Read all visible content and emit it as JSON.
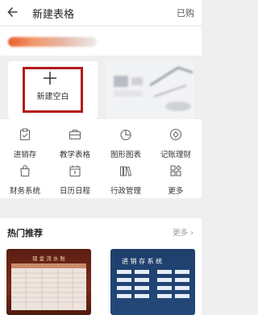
{
  "header": {
    "title": "新建表格",
    "purchased_label": "已购"
  },
  "cards": {
    "new_blank_label": "新建空白"
  },
  "grid": {
    "items": [
      {
        "label": "进销存",
        "icon": "clipboard-check-icon"
      },
      {
        "label": "教学表格",
        "icon": "briefcase-icon"
      },
      {
        "label": "图形图表",
        "icon": "pie-chart-icon"
      },
      {
        "label": "记账理财",
        "icon": "diamond-icon"
      },
      {
        "label": "财务系统",
        "icon": "bag-icon"
      },
      {
        "label": "日历日程",
        "icon": "calendar-icon"
      },
      {
        "label": "行政管理",
        "icon": "books-icon"
      },
      {
        "label": "更多",
        "icon": "grid-more-icon"
      }
    ]
  },
  "hot": {
    "title": "热门推荐",
    "more_label": "更多",
    "templates": [
      {
        "title": "现 金 流 水 账"
      },
      {
        "title": "进 销 存 系 统"
      }
    ]
  },
  "colors": {
    "accent_red": "#b51919",
    "banner_orange": "#e85d2b"
  }
}
